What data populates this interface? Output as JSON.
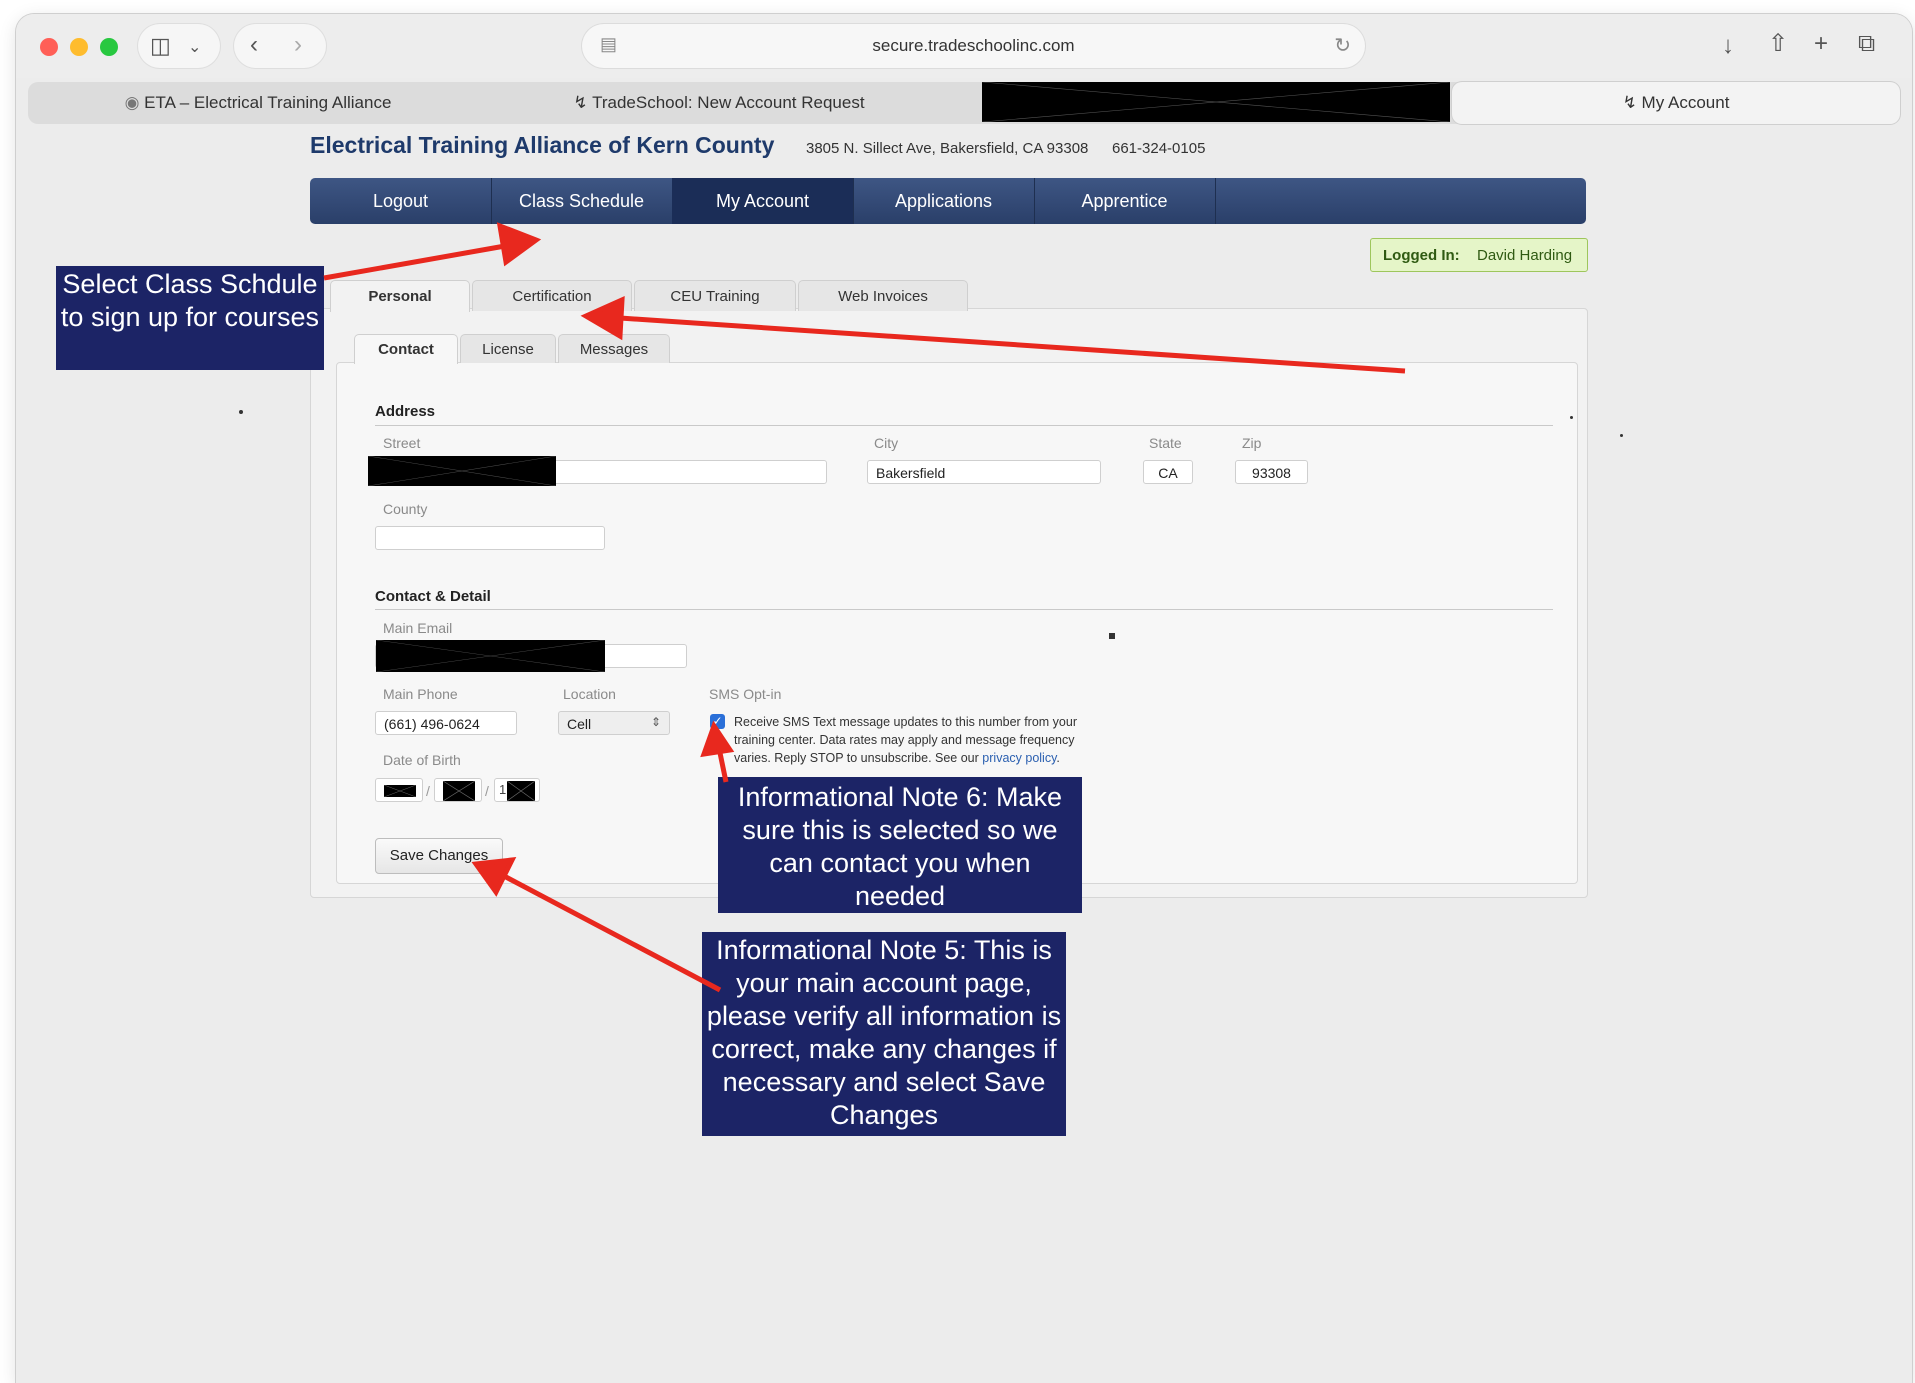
{
  "browser": {
    "url": "secure.tradeschoolinc.com",
    "tabs": [
      {
        "label": "ETA – Electrical Training Alliance",
        "icon": "eta-favicon-icon"
      },
      {
        "label": "TradeSchool: New Account Request",
        "icon": "tradeschool-icon"
      },
      {
        "label": "",
        "icon": ""
      },
      {
        "label": "My Account",
        "icon": "tradeschool-icon",
        "active": true
      }
    ]
  },
  "header": {
    "title": "Electrical Training Alliance of Kern County",
    "address": "3805 N. Sillect Ave, Bakersfield, CA 93308",
    "phone": "661-324-0105"
  },
  "nav": {
    "items": [
      "Logout",
      "Class Schedule",
      "My Account",
      "Applications",
      "Apprentice"
    ],
    "active": "My Account"
  },
  "logged_in": {
    "label": "Logged In:",
    "user": "David Harding"
  },
  "sub_tabs": [
    "Personal",
    "Certification",
    "CEU Training",
    "Web Invoices"
  ],
  "inner_tabs": [
    "Contact",
    "License",
    "Messages"
  ],
  "form": {
    "address_section": "Address",
    "street_label": "Street",
    "street_value": "",
    "city_label": "City",
    "city_value": "Bakersfield",
    "state_label": "State",
    "state_value": "CA",
    "zip_label": "Zip",
    "zip_value": "93308",
    "county_label": "County",
    "county_value": "",
    "contact_section": "Contact & Detail",
    "email_label": "Main Email",
    "phone_label": "Main Phone",
    "phone_value": "(661) 496-0624",
    "location_label": "Location",
    "location_value": "Cell",
    "sms_label": "SMS Opt-in",
    "sms_checked": true,
    "sms_text": "Receive SMS Text message updates to this number from your training center. Data rates may apply and message frequency varies. Reply STOP to unsubscribe. See our",
    "sms_link": "privacy policy",
    "dob_label": "Date of Birth",
    "dob_year_prefix": "1",
    "save_label": "Save Changes"
  },
  "notes": {
    "class_schedule": "Select Class Schdule to sign up for courses",
    "note6": "Informational Note 6: Make sure this is selected so we can contact you when needed",
    "note5": "Informational Note 5: This is your main account page, please verify all information is correct, make any changes if necessary and select Save Changes"
  },
  "colors": {
    "nav_bg": "#2a3f69",
    "nav_active": "#1b2d57",
    "note_bg": "#1c2466",
    "arrow": "#e8281e",
    "logged_in_bg": "#e5f5c8"
  }
}
